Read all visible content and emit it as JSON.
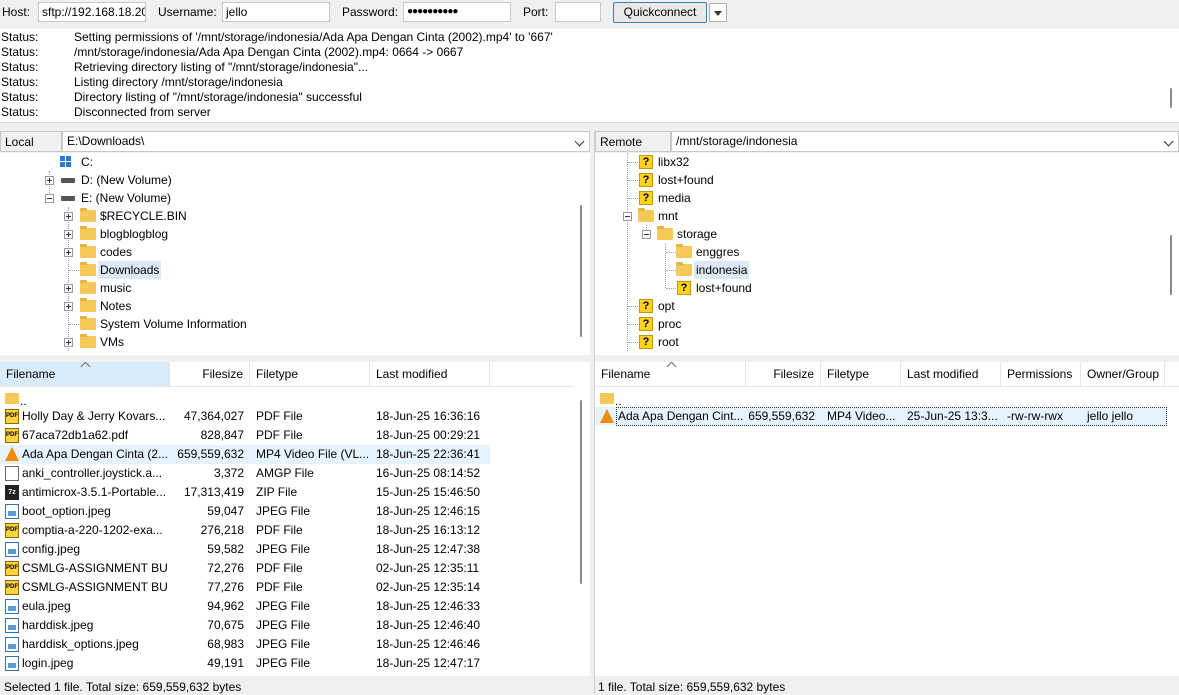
{
  "quickconnect": {
    "host_label": "Host:",
    "host_value": "sftp://192.168.18.20",
    "username_label": "Username:",
    "username_value": "jello",
    "password_label": "Password:",
    "password_value": "●●●●●●●●●●",
    "port_label": "Port:",
    "port_value": "",
    "button_label": "Quickconnect"
  },
  "log": [
    {
      "key": "Status:",
      "text": "Setting permissions of '/mnt/storage/indonesia/Ada Apa Dengan Cinta (2002).mp4' to '667'"
    },
    {
      "key": "Status:",
      "text": "/mnt/storage/indonesia/Ada Apa Dengan Cinta (2002).mp4: 0664 -> 0667"
    },
    {
      "key": "Status:",
      "text": "Retrieving directory listing of \"/mnt/storage/indonesia\"..."
    },
    {
      "key": "Status:",
      "text": "Listing directory /mnt/storage/indonesia"
    },
    {
      "key": "Status:",
      "text": "Directory listing of \"/mnt/storage/indonesia\" successful"
    },
    {
      "key": "Status:",
      "text": "Disconnected from server"
    }
  ],
  "local": {
    "site_label": "Local site:",
    "path": "E:\\Downloads\\",
    "tree": [
      {
        "label": "C:",
        "icon": "windows-icon"
      },
      {
        "label": "D: (New Volume)",
        "icon": "drive-icon"
      },
      {
        "label": "E: (New Volume)",
        "icon": "drive-icon"
      },
      {
        "label": "$RECYCLE.BIN",
        "icon": "folder-icon"
      },
      {
        "label": "blogblogblog",
        "icon": "folder-icon"
      },
      {
        "label": "codes",
        "icon": "folder-icon"
      },
      {
        "label": "Downloads",
        "icon": "folder-icon"
      },
      {
        "label": "music",
        "icon": "folder-icon"
      },
      {
        "label": "Notes",
        "icon": "folder-icon"
      },
      {
        "label": "System Volume Information",
        "icon": "folder-icon"
      },
      {
        "label": "VMs",
        "icon": "folder-icon"
      }
    ],
    "columns": {
      "name": "Filename",
      "size": "Filesize",
      "type": "Filetype",
      "modified": "Last modified"
    },
    "parent": "..",
    "files": [
      {
        "name": "Holly Day & Jerry Kovars...",
        "size": "47,364,027",
        "type": "PDF File",
        "modified": "18-Jun-25 16:36:16",
        "icon": "pdf"
      },
      {
        "name": "67aca72db1a62.pdf",
        "size": "828,847",
        "type": "PDF File",
        "modified": "18-Jun-25 00:29:21",
        "icon": "pdf"
      },
      {
        "name": "Ada Apa Dengan Cinta (2...",
        "size": "659,559,632",
        "type": "MP4 Video File (VL...",
        "modified": "18-Jun-25 22:36:41",
        "icon": "vlc"
      },
      {
        "name": "anki_controller.joystick.a...",
        "size": "3,372",
        "type": "AMGP File",
        "modified": "16-Jun-25 08:14:52",
        "icon": "doc"
      },
      {
        "name": "antimicrox-3.5.1-Portable...",
        "size": "17,313,419",
        "type": "ZIP File",
        "modified": "15-Jun-25 15:46:50",
        "icon": "zip"
      },
      {
        "name": "boot_option.jpeg",
        "size": "59,047",
        "type": "JPEG File",
        "modified": "18-Jun-25 12:46:15",
        "icon": "img"
      },
      {
        "name": "comptia-a-220-1202-exa...",
        "size": "276,218",
        "type": "PDF File",
        "modified": "18-Jun-25 16:13:12",
        "icon": "pdf"
      },
      {
        "name": "config.jpeg",
        "size": "59,582",
        "type": "JPEG File",
        "modified": "18-Jun-25 12:47:38",
        "icon": "img"
      },
      {
        "name": "CSMLG-ASSIGNMENT BU...",
        "size": "72,276",
        "type": "PDF File",
        "modified": "02-Jun-25 12:35:11",
        "icon": "pdf"
      },
      {
        "name": "CSMLG-ASSIGNMENT BU...",
        "size": "77,276",
        "type": "PDF File",
        "modified": "02-Jun-25 12:35:14",
        "icon": "pdf"
      },
      {
        "name": "eula.jpeg",
        "size": "94,962",
        "type": "JPEG File",
        "modified": "18-Jun-25 12:46:33",
        "icon": "img"
      },
      {
        "name": "harddisk.jpeg",
        "size": "70,675",
        "type": "JPEG File",
        "modified": "18-Jun-25 12:46:40",
        "icon": "img"
      },
      {
        "name": "harddisk_options.jpeg",
        "size": "68,983",
        "type": "JPEG File",
        "modified": "18-Jun-25 12:46:46",
        "icon": "img"
      },
      {
        "name": "login.jpeg",
        "size": "49,191",
        "type": "JPEG File",
        "modified": "18-Jun-25 12:47:17",
        "icon": "img"
      }
    ],
    "status": "Selected 1 file. Total size: 659,559,632 bytes"
  },
  "remote": {
    "site_label": "Remote site:",
    "path": "/mnt/storage/indonesia",
    "tree": [
      {
        "label": "libx32",
        "icon": "unknown-folder-icon"
      },
      {
        "label": "lost+found",
        "icon": "unknown-folder-icon"
      },
      {
        "label": "media",
        "icon": "unknown-folder-icon"
      },
      {
        "label": "mnt",
        "icon": "folder-icon"
      },
      {
        "label": "storage",
        "icon": "folder-icon"
      },
      {
        "label": "enggres",
        "icon": "folder-icon"
      },
      {
        "label": "indonesia",
        "icon": "folder-icon"
      },
      {
        "label": "lost+found",
        "icon": "unknown-folder-icon"
      },
      {
        "label": "opt",
        "icon": "unknown-folder-icon"
      },
      {
        "label": "proc",
        "icon": "unknown-folder-icon"
      },
      {
        "label": "root",
        "icon": "unknown-folder-icon"
      }
    ],
    "columns": {
      "name": "Filename",
      "size": "Filesize",
      "type": "Filetype",
      "modified": "Last modified",
      "perms": "Permissions",
      "owner": "Owner/Group"
    },
    "parent": "..",
    "files": [
      {
        "name": "Ada Apa Dengan Cint...",
        "size": "659,559,632",
        "type": "MP4 Video...",
        "modified": "25-Jun-25 13:3...",
        "perms": "-rw-rw-rwx",
        "owner": "jello jello",
        "icon": "vlc"
      }
    ],
    "status": "1 file. Total size: 659,559,632 bytes"
  }
}
